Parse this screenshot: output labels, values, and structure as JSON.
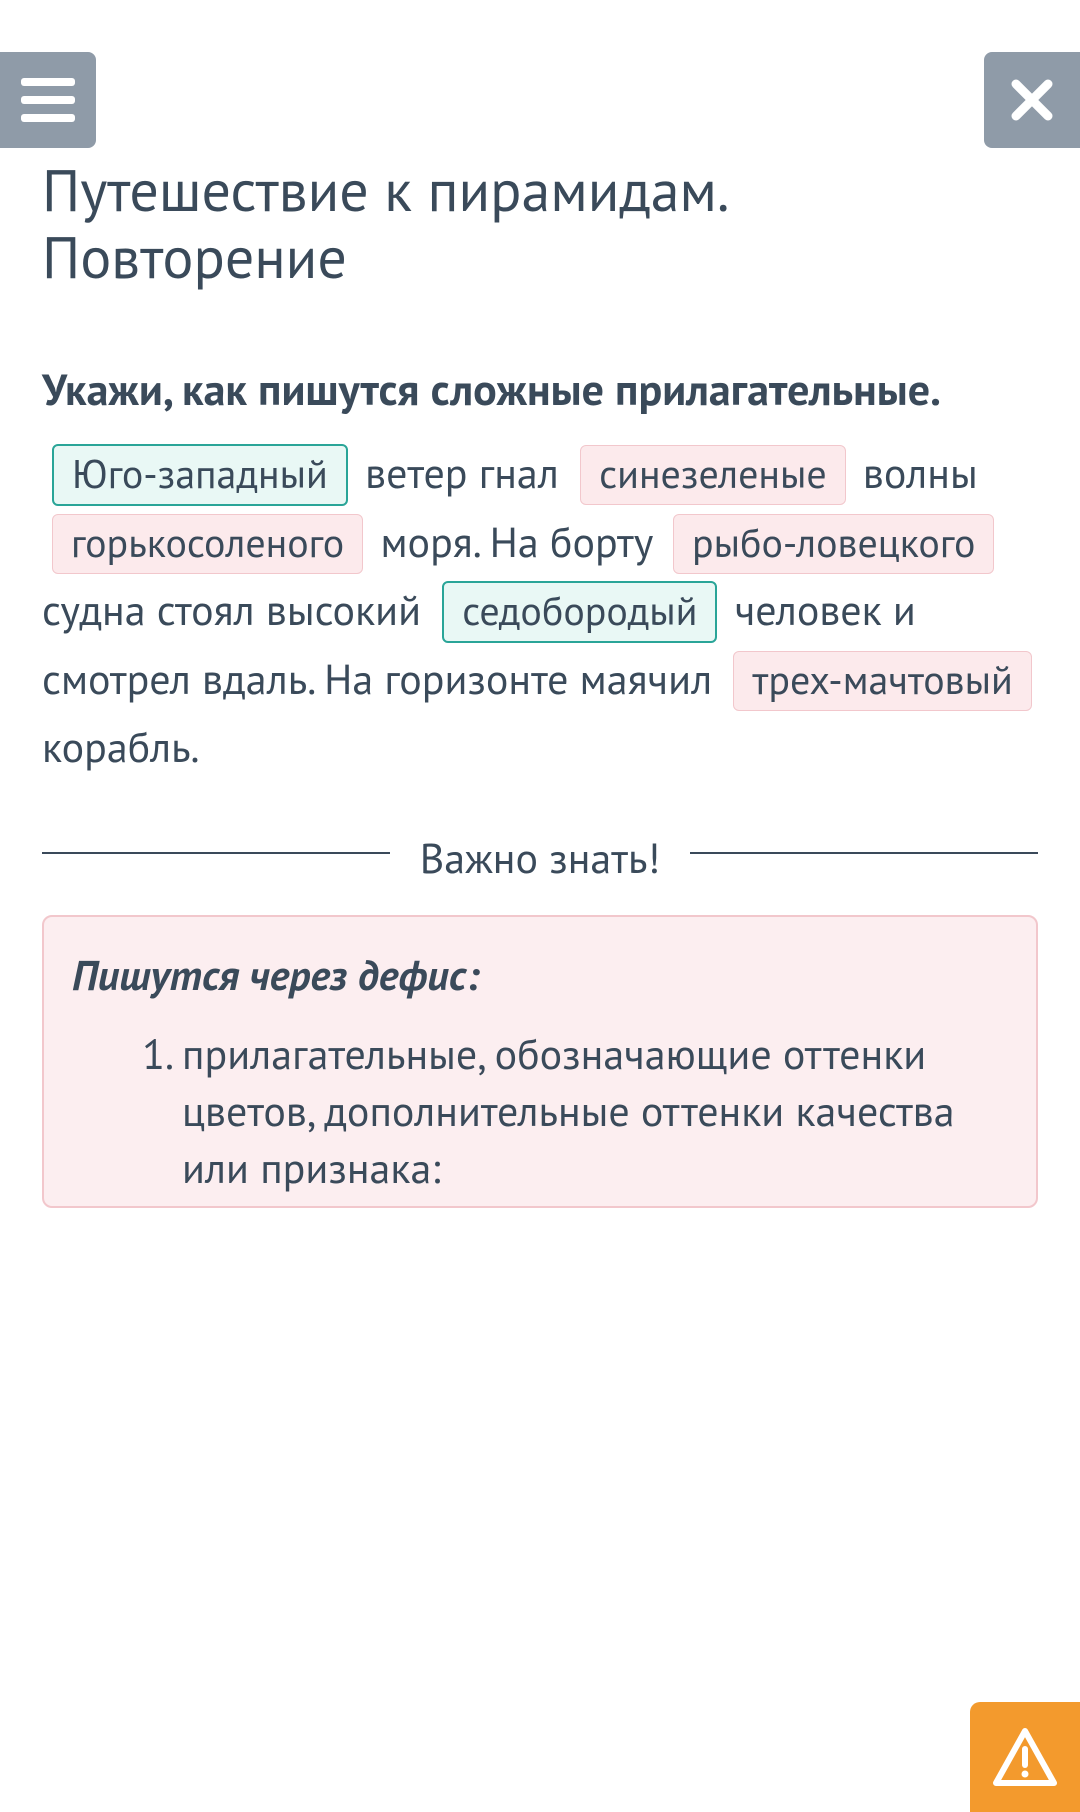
{
  "page": {
    "title": "Путешествие к пирамидам. Повторение"
  },
  "exercise": {
    "instruction": "Укажи, как пишутся сложные прилагательные.",
    "text1": " ветер гнал ",
    "text2": " волны ",
    "text3": " моря. На борту ",
    "text4": " судна стоял высокий ",
    "text5": " человек и смотрел вдаль. На горизонте маячил ",
    "text6": " корабль.",
    "chips": {
      "c1": "Юго-западный",
      "c2": "синезеленые",
      "c3": "горькосоленого",
      "c4": "рыбо-ловецкого",
      "c5": "седобородый",
      "c6": "трех-мачтовый"
    }
  },
  "divider": {
    "label": "Важно знать!"
  },
  "info": {
    "title": "Пишутся через дефис:",
    "item1": "прилагательные, обозначающие оттенки цветов, дополнительные оттенки качества или признака:"
  }
}
